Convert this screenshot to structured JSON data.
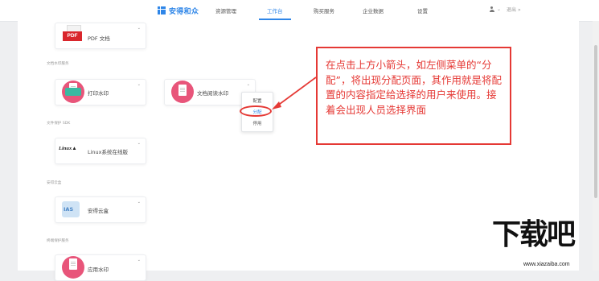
{
  "nav": {
    "brand": "安得和众",
    "items": [
      {
        "label": "资源管理",
        "active": false
      },
      {
        "label": "工作台",
        "active": true
      },
      {
        "label": "购买服务",
        "active": false
      },
      {
        "label": "企业数据",
        "active": false
      },
      {
        "label": "设置",
        "active": false
      }
    ],
    "user_arrow": "⌄",
    "user_text": "退出 »"
  },
  "sections": [
    {
      "label": "文档水印服务"
    },
    {
      "label": "文件保护 SDK"
    },
    {
      "label": "安得云盒"
    },
    {
      "label": "终端保护服务"
    }
  ],
  "cards": [
    {
      "label": "PDF 文档",
      "icon": "pdf-icon"
    },
    {
      "label": "打印水印",
      "icon": "printer-watermark-icon"
    },
    {
      "label": "文档阅读水印",
      "icon": "document-watermark-icon"
    },
    {
      "label": "Linux系统在线版",
      "icon": "linux-icon"
    },
    {
      "label": "安得云盒",
      "icon": "cloud-box-icon"
    },
    {
      "label": "应用水印",
      "icon": "app-watermark-icon"
    }
  ],
  "dropdown": {
    "items": [
      "配置",
      "分配",
      "停用"
    ],
    "highlighted": "分配"
  },
  "callout": {
    "text": "在点击上方小箭头，如左侧菜单的“分配”，将出现分配页面，其作用就是将配置的内容指定给选择的用户来使用。接着会出现人员选择界面"
  },
  "watermark": {
    "big": "下载吧",
    "url": "www.xiazaiba.com"
  },
  "colors": {
    "accent": "#2f86e8",
    "annotation": "#e53935",
    "icon_pink": "#e8557a"
  }
}
